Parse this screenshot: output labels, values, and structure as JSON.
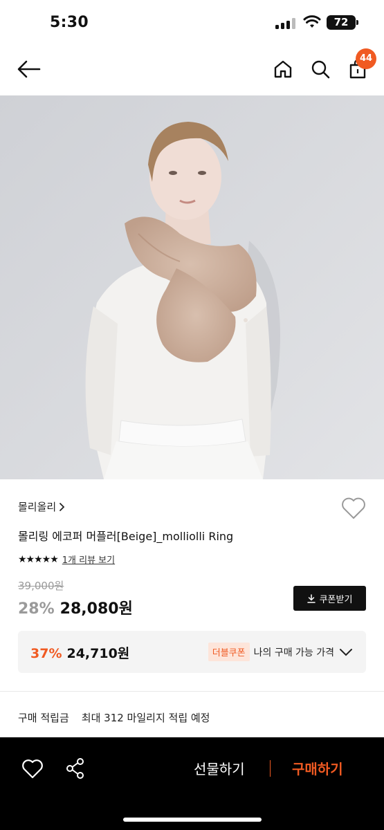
{
  "status_bar": {
    "time": "5:30",
    "battery": "72"
  },
  "nav": {
    "cart_count": "44"
  },
  "product": {
    "brand": "몰리올리",
    "title": "몰리링 에코퍼 머플러[Beige]_molliolli Ring",
    "stars": "★★★★★",
    "review_link": "1개 리뷰 보기",
    "original_price": "39,000원",
    "discount_rate": "28%",
    "sale_price": "28,080원",
    "coupon_label": "쿠폰받기"
  },
  "double_coupon": {
    "rate": "37%",
    "price": "24,710원",
    "tag": "더블쿠폰",
    "label": "나의 구매 가능 가격"
  },
  "mileage": {
    "label": "구매 적립금",
    "value": "최대 312 마일리지 적립 예정"
  },
  "bottom_bar": {
    "gift_label": "선물하기",
    "buy_label": "구매하기"
  },
  "colors": {
    "accent": "#f05a22",
    "dark": "#111111",
    "muted": "#9a9a9a"
  },
  "icons": [
    "back-arrow-icon",
    "home-icon",
    "search-icon",
    "cart-icon",
    "heart-icon",
    "share-icon",
    "download-icon",
    "chevron-down-icon",
    "chevron-right-icon"
  ]
}
